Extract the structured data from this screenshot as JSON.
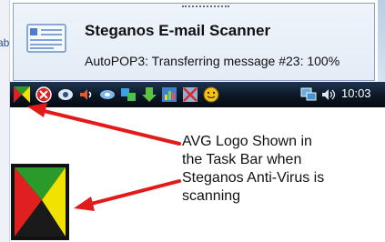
{
  "popup": {
    "title": "Steganos E-mail Scanner",
    "message": "AutoPOP3: Transferring message #23: 100%"
  },
  "left_fragment_text": "ab",
  "taskbar": {
    "clock": "10:03",
    "tray_icons": [
      "avg-logo-icon",
      "shield-stop-icon",
      "media-icon",
      "speaker-icon",
      "network-icon",
      "bluetooth-icon",
      "download-icon",
      "chart-icon",
      "no-entry-icon",
      "smiley-icon",
      "network-computer-icon",
      "volume-icon"
    ]
  },
  "callout": {
    "lines": [
      "AVG Logo Shown in",
      "the Task Bar when",
      "Steganos Anti-Virus is",
      "scanning"
    ]
  },
  "colors": {
    "arrow": "#e21a1a",
    "taskbar": "#0c1726",
    "logo_red": "#e02020",
    "logo_green": "#2a9a2a",
    "logo_yellow": "#f2e200"
  }
}
